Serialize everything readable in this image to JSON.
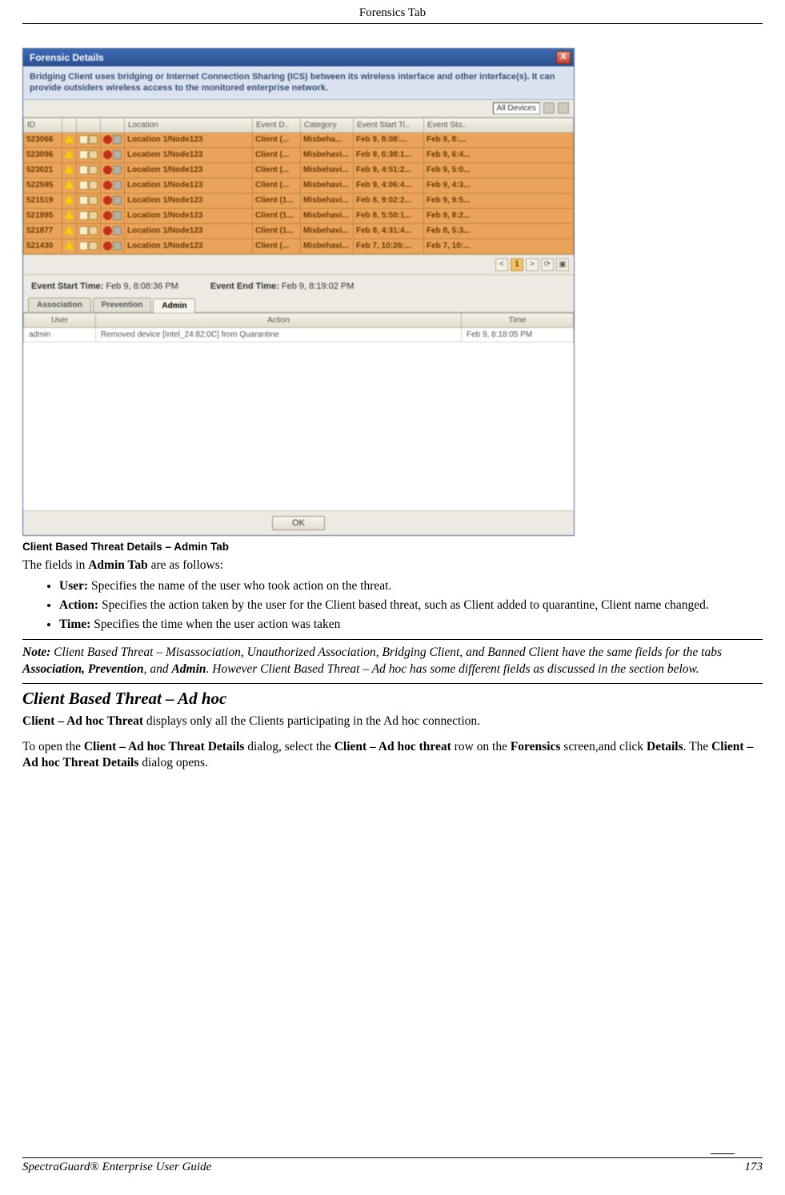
{
  "header": "Forensics Tab",
  "dialog": {
    "title": "Forensic Details",
    "description": "Bridging Client uses bridging or Internet Connection Sharing (ICS) between its wireless interface and other interface(s). It can provide outsiders wireless access to the monitored enterprise network.",
    "filter_select": "All Devices",
    "columns": [
      "ID",
      "",
      "",
      "",
      "Location",
      "Event D..",
      "Category",
      "Event Start Ti..",
      "Event Sto.."
    ],
    "rows": [
      {
        "id": "523066",
        "loc": "Location 1/Node123",
        "ev": "Client (...",
        "cat": "Misbeha...",
        "start": "Feb 9, 8:08:...",
        "stop": "Feb 9, 8:..."
      },
      {
        "id": "523096",
        "loc": "Location 1/Node123",
        "ev": "Client (...",
        "cat": "Misbehavi...",
        "start": "Feb 9, 6:38:1...",
        "stop": "Feb 9, 6:4..."
      },
      {
        "id": "523021",
        "loc": "Location 1/Node123",
        "ev": "Client (...",
        "cat": "Misbehavi...",
        "start": "Feb 9, 4:51:2...",
        "stop": "Feb 9, 5:0..."
      },
      {
        "id": "522595",
        "loc": "Location 1/Node123",
        "ev": "Client (...",
        "cat": "Misbehavi...",
        "start": "Feb 9, 4:06:4...",
        "stop": "Feb 9, 4:3..."
      },
      {
        "id": "521519",
        "loc": "Location 1/Node123",
        "ev": "Client (1...",
        "cat": "Misbehavi...",
        "start": "Feb 8, 9:02:2...",
        "stop": "Feb 9, 9:5..."
      },
      {
        "id": "521995",
        "loc": "Location 1/Node123",
        "ev": "Client (1...",
        "cat": "Misbehavi...",
        "start": "Feb 8, 5:50:1...",
        "stop": "Feb 9, 8:2..."
      },
      {
        "id": "521877",
        "loc": "Location 1/Node123",
        "ev": "Client (1...",
        "cat": "Misbehavi...",
        "start": "Feb 8, 4:31:4...",
        "stop": "Feb 8, 5:3..."
      },
      {
        "id": "521430",
        "loc": "Location 1/Node123",
        "ev": "Client (...",
        "cat": "Misbehavi...",
        "start": "Feb 7, 10:26:...",
        "stop": "Feb 7, 10:..."
      }
    ],
    "pager_current": "1",
    "start_label": "Event Start Time:",
    "start_val": "Feb 9, 8:08:36 PM",
    "end_label": "Event End Time:",
    "end_val": "Feb 9, 8:19:02 PM",
    "tabs": [
      "Association",
      "Prevention",
      "Admin"
    ],
    "admin_cols": [
      "User",
      "Action",
      "Time"
    ],
    "admin_row": {
      "user": "admin",
      "action": "Removed device [Intel_24:82:0C] from Quarantine",
      "time": "Feb 9, 8:18:05 PM"
    },
    "ok": "OK"
  },
  "caption": "Client Based Threat Details – Admin Tab",
  "intro": "The fields in ",
  "intro_bold": "Admin Tab",
  "intro_tail": " are as follows:",
  "fields": [
    {
      "label": "User:",
      "text": " Specifies the name of the user who took action on the threat."
    },
    {
      "label": "Action:",
      "text": " Specifies the action taken by the user for the Client based threat, such as Client added to quarantine, Client name changed."
    },
    {
      "label": "Time:",
      "text": " Specifies the time when the user action was taken"
    }
  ],
  "note_pre": "Note:",
  "note_body": " Client Based Threat – Misassociation, Unauthorized Association, Bridging Client, and Banned Client have the same fields for the tabs ",
  "note_b1": "Association, Prevention",
  "note_mid": ", and ",
  "note_b2": "Admin",
  "note_tail": ". However Client Based Threat – Ad hoc has some different fields as discussed in the section below.",
  "section_title": "Client Based Threat – Ad hoc",
  "p1_b": "Client – Ad hoc Threat",
  "p1_t": " displays only all the Clients participating in the Ad hoc connection.",
  "p2_a": "To open the ",
  "p2_b1": "Client – Ad hoc Threat Details",
  "p2_c": " dialog, select the ",
  "p2_b2": "Client – Ad hoc threat",
  "p2_d": " row on the ",
  "p2_b3": "Forensics",
  "p2_e": " screen,and click ",
  "p2_b4": "Details",
  "p2_f": ". The ",
  "p2_b5": "Client – Ad hoc Threat Details",
  "p2_g": " dialog opens.",
  "footer_title": "SpectraGuard® Enterprise User Guide",
  "footer_page": "173"
}
